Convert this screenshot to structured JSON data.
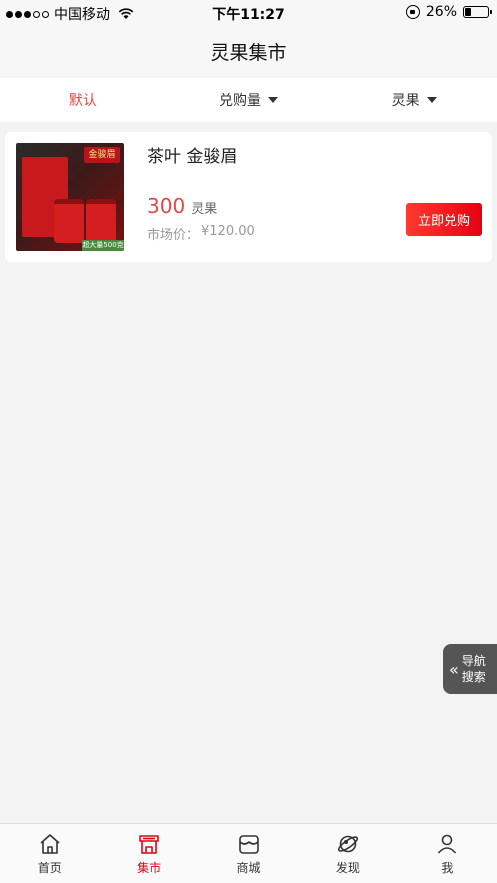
{
  "status_bar": {
    "carrier": "中国移动",
    "time": "下午11:27",
    "battery": "26%",
    "battery_level": 0.26
  },
  "nav": {
    "title": "灵果集市"
  },
  "filters": [
    {
      "label": "默认",
      "active": true
    },
    {
      "label": "兑购量",
      "active": false
    },
    {
      "label": "灵果",
      "active": false
    }
  ],
  "product": {
    "name": "茶叶 金骏眉",
    "price": "300",
    "unit": "灵果",
    "market_label": "市场价：",
    "market_price": "¥120.00",
    "button": "立即兑购",
    "image_tag": "金骏眉",
    "image_badge": "超大量500克"
  },
  "float_nav": {
    "line1": "导航",
    "line2": "搜索"
  },
  "tabs": [
    {
      "label": "首页",
      "icon": "home-icon",
      "active": false
    },
    {
      "label": "集市",
      "icon": "market-icon",
      "active": true
    },
    {
      "label": "商城",
      "icon": "store-icon",
      "active": false
    },
    {
      "label": "发现",
      "icon": "discover-icon",
      "active": false
    },
    {
      "label": "我",
      "icon": "profile-icon",
      "active": false
    }
  ],
  "colors": {
    "accent": "#e54646",
    "active_tab": "#e60012"
  }
}
